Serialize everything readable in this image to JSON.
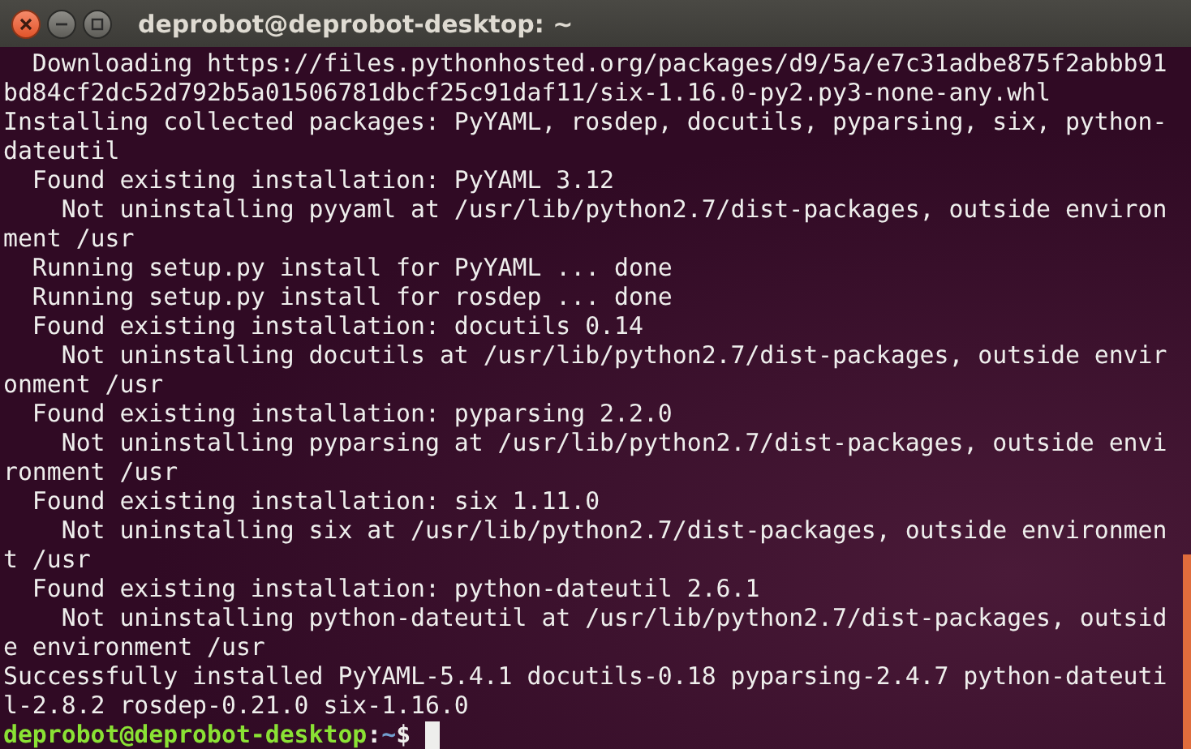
{
  "window": {
    "title": "deprobot@deprobot-desktop: ~"
  },
  "terminal": {
    "lines": [
      "  Downloading https://files.pythonhosted.org/packages/d9/5a/e7c31adbe875f2abbb91",
      "bd84cf2dc52d792b5a01506781dbcf25c91daf11/six-1.16.0-py2.py3-none-any.whl",
      "Installing collected packages: PyYAML, rosdep, docutils, pyparsing, six, python-",
      "dateutil",
      "  Found existing installation: PyYAML 3.12",
      "    Not uninstalling pyyaml at /usr/lib/python2.7/dist-packages, outside environ",
      "ment /usr",
      "  Running setup.py install for PyYAML ... done",
      "  Running setup.py install for rosdep ... done",
      "  Found existing installation: docutils 0.14",
      "    Not uninstalling docutils at /usr/lib/python2.7/dist-packages, outside envir",
      "onment /usr",
      "  Found existing installation: pyparsing 2.2.0",
      "    Not uninstalling pyparsing at /usr/lib/python2.7/dist-packages, outside envi",
      "ronment /usr",
      "  Found existing installation: six 1.11.0",
      "    Not uninstalling six at /usr/lib/python2.7/dist-packages, outside environmen",
      "t /usr",
      "  Found existing installation: python-dateutil 2.6.1",
      "    Not uninstalling python-dateutil at /usr/lib/python2.7/dist-packages, outsid",
      "e environment /usr",
      "Successfully installed PyYAML-5.4.1 docutils-0.18 pyparsing-2.4.7 python-dateuti",
      "l-2.8.2 rosdep-0.21.0 six-1.16.0"
    ],
    "prompt": {
      "user_host": "deprobot@deprobot-desktop",
      "separator": ":",
      "path": "~",
      "symbol": "$"
    }
  }
}
